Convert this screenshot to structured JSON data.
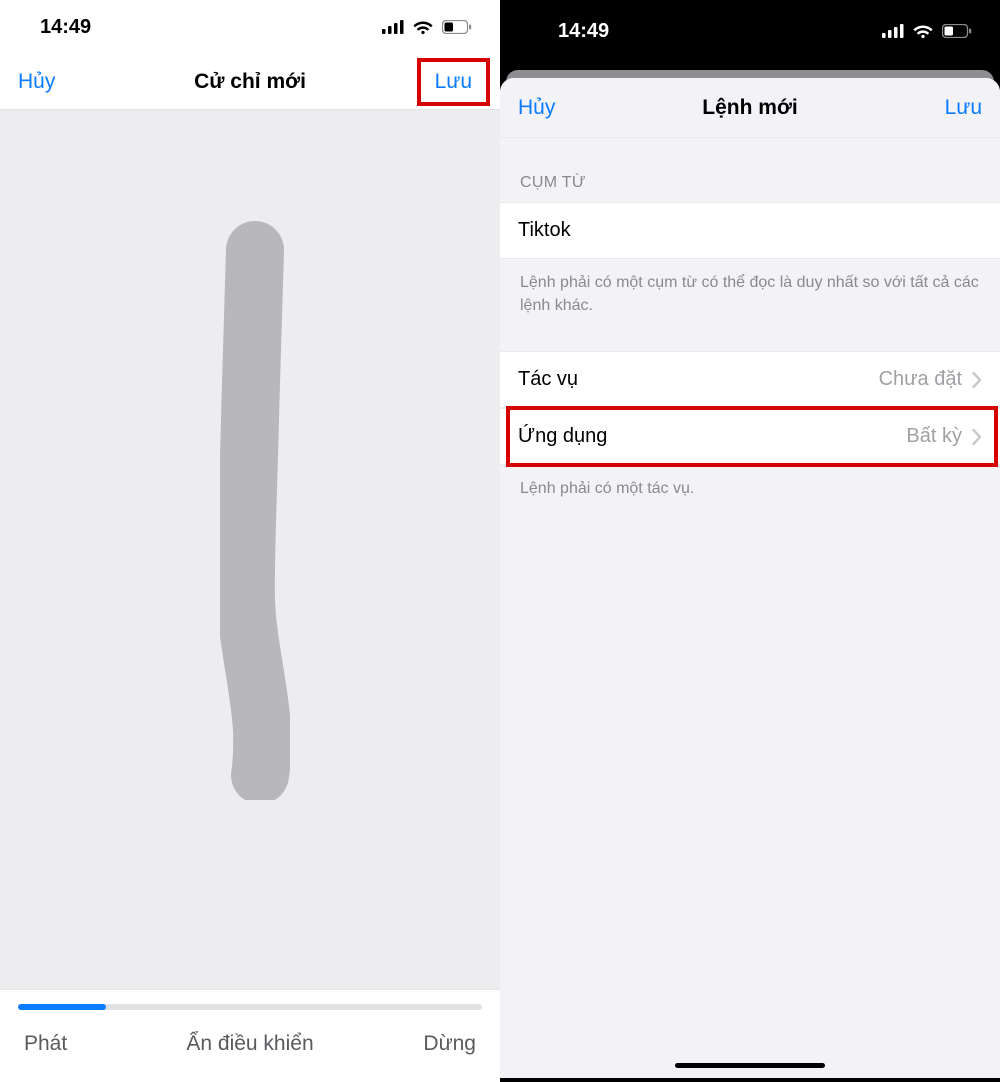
{
  "left": {
    "status_time": "14:49",
    "nav": {
      "cancel": "Hủy",
      "title": "Cử chỉ mới",
      "save": "Lưu"
    },
    "toolbar": {
      "play": "Phát",
      "hide": "Ẩn điều khiển",
      "stop": "Dừng"
    }
  },
  "right": {
    "status_time": "14:49",
    "nav": {
      "cancel": "Hủy",
      "title": "Lệnh mới",
      "save": "Lưu"
    },
    "section_phrase_header": "CỤM TỪ",
    "phrase_value": "Tiktok",
    "phrase_footer": "Lệnh phải có một cụm từ có thể đọc là duy nhất so với tất cả các lệnh khác.",
    "task": {
      "label": "Tác vụ",
      "value": "Chưa đặt"
    },
    "app": {
      "label": "Ứng dụng",
      "value": "Bất kỳ"
    },
    "task_footer": "Lệnh phải có một tác vụ."
  }
}
